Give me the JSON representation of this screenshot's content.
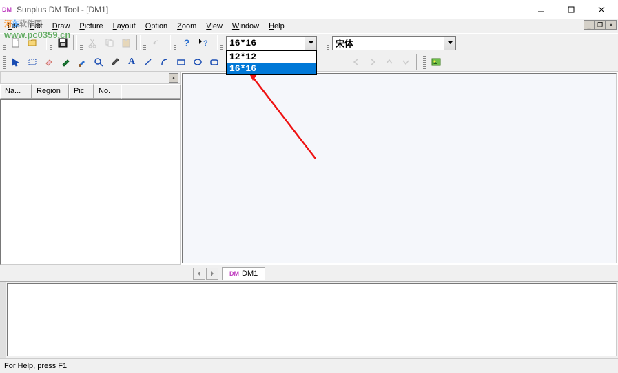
{
  "window": {
    "title": "Sunplus DM Tool - [DM1]",
    "appicon_text": "DM"
  },
  "menu": {
    "items": [
      "File",
      "Edit",
      "Draw",
      "Picture",
      "Layout",
      "Option",
      "Zoom",
      "View",
      "Window",
      "Help"
    ]
  },
  "toolbar": {
    "size_combo": {
      "value": "16*16",
      "options": [
        "12*12",
        "16*16"
      ],
      "selected_index": 1
    },
    "font_combo": {
      "value": "宋体"
    }
  },
  "sidepanel": {
    "columns": [
      "Na...",
      "Region",
      "Pic",
      "No."
    ]
  },
  "tabs": {
    "doc1": "DM1"
  },
  "statusbar": {
    "text": "For Help, press F1"
  },
  "watermark": {
    "line1": "河东软件园",
    "line2": "www.pc0359.cn"
  }
}
